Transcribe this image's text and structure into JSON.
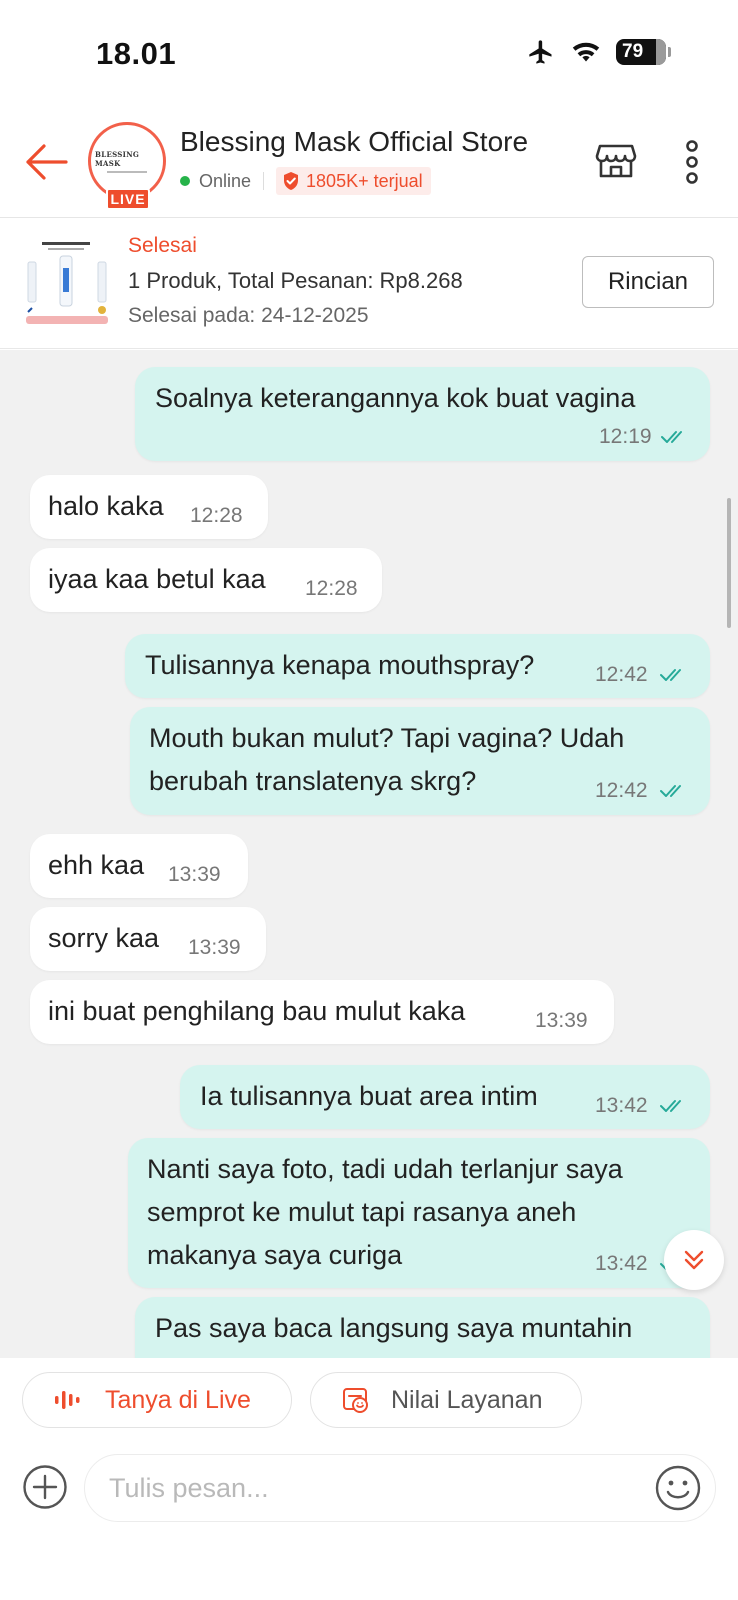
{
  "status_bar": {
    "time": "18.01",
    "battery": "79",
    "icons": [
      "airplane-icon",
      "wifi-icon",
      "battery-icon"
    ]
  },
  "header": {
    "store_name": "Blessing Mask Official Store",
    "live_label": "LIVE",
    "avatar_logo_text": "BLESSING MASK",
    "online_label": "Online",
    "sold_label": "1805K+ terjual",
    "icons": [
      "back-arrow-icon",
      "shop-icon",
      "more-vertical-icon",
      "shield-check-icon"
    ]
  },
  "order": {
    "status": "Selesai",
    "summary": "1 Produk, Total Pesanan: Rp8.268",
    "completed_at": "Selesai pada: 24-12-2025",
    "details_button": "Rincian"
  },
  "messages": [
    {
      "dir": "out",
      "text": "Soalnya keterangannya kok buat vagina",
      "time": "12:19",
      "read": true
    },
    {
      "dir": "in",
      "text": "halo kaka",
      "time": "12:28"
    },
    {
      "dir": "in",
      "text": "iyaa kaa betul kaa",
      "time": "12:28"
    },
    {
      "dir": "out",
      "text": "Tulisannya kenapa mouthspray?",
      "time": "12:42",
      "read": true
    },
    {
      "dir": "out",
      "lines": [
        "Mouth bukan mulut? Tapi vagina? Udah",
        "berubah translatenya skrg?"
      ],
      "time": "12:42",
      "read": true
    },
    {
      "dir": "in",
      "text": "ehh kaa",
      "time": "13:39"
    },
    {
      "dir": "in",
      "text": "sorry kaa",
      "time": "13:39"
    },
    {
      "dir": "in",
      "text": "ini buat penghilang bau mulut kaka",
      "time": "13:39"
    },
    {
      "dir": "out",
      "text": "Ia tulisannya buat area intim",
      "time": "13:42",
      "read": true
    },
    {
      "dir": "out",
      "lines": [
        "Nanti saya foto, tadi udah terlanjur saya",
        "semprot ke mulut tapi rasanya aneh",
        "makanya saya curiga"
      ],
      "time": "13:42",
      "read": true
    },
    {
      "dir": "out",
      "text": "Pas saya baca langsung saya muntahin",
      "partial": true
    }
  ],
  "quick_actions": {
    "ask_live": "Tanya di Live",
    "rate_service": "Nilai Layanan"
  },
  "composer": {
    "placeholder": "Tulis pesan..."
  },
  "colors": {
    "brand": "#ee4d2d",
    "outgoing_bubble": "#d5f4ef",
    "incoming_bubble": "#ffffff",
    "chat_background": "#f1f1f1",
    "read_tick": "#26aa99",
    "online": "#26b34a"
  }
}
